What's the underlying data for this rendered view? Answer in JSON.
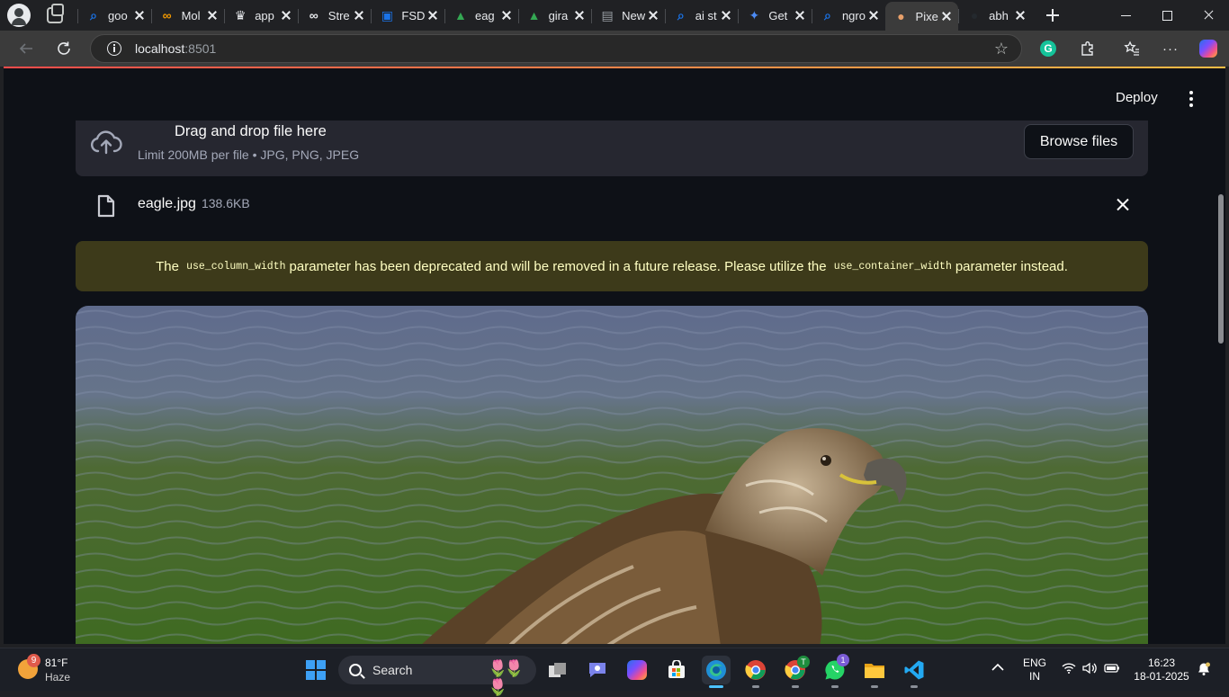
{
  "browser": {
    "tabs": [
      {
        "label": "goo",
        "favicon": "search-icon",
        "color": "#1a73e8"
      },
      {
        "label": "Mol",
        "favicon": "infinity-icon",
        "color": "#f29900"
      },
      {
        "label": "app",
        "favicon": "crown-icon",
        "color": "#e8eaed"
      },
      {
        "label": "Stre",
        "favicon": "infinity-icon",
        "color": "#e8eaed"
      },
      {
        "label": "FSD",
        "favicon": "classroom-icon",
        "color": "#1a73e8"
      },
      {
        "label": "eag",
        "favicon": "drive-icon",
        "color": "#34a853"
      },
      {
        "label": "gira",
        "favicon": "drive-icon",
        "color": "#34a853"
      },
      {
        "label": "New",
        "favicon": "page-icon",
        "color": "#9aa0a6"
      },
      {
        "label": "ai st",
        "favicon": "search-icon",
        "color": "#1a73e8"
      },
      {
        "label": "Get",
        "favicon": "butterfly-icon",
        "color": "#4c8bf5"
      },
      {
        "label": "ngro",
        "favicon": "search-icon",
        "color": "#1a73e8"
      },
      {
        "label": "Pixe",
        "favicon": "palette-icon",
        "color": "#e8a06a"
      },
      {
        "label": "abh",
        "favicon": "github-icon",
        "color": "#24292e"
      }
    ],
    "active_tab_index": 11,
    "url_host": "localhost",
    "url_port": ":8501"
  },
  "app": {
    "deploy_label": "Deploy",
    "uploader": {
      "title": "Drag and drop file here",
      "subtitle": "Limit 200MB per file • JPG, PNG, JPEG",
      "browse_label": "Browse files"
    },
    "file": {
      "name": "eagle.jpg",
      "size": "138.6KB"
    },
    "warning": {
      "pre": "The",
      "code1": "use_column_width",
      "mid": "parameter has been deprecated and will be removed in a future release. Please utilize the",
      "code2": "use_container_width",
      "post": "parameter instead."
    },
    "accent_color": "#ff4b4b",
    "warning_bg": "#3d3a1a",
    "warning_fg": "#ffffc2"
  },
  "taskbar": {
    "weather_temp": "81°F",
    "weather_desc": "Haze",
    "weather_badge": "9",
    "search_label": "Search",
    "lang_line1": "ENG",
    "lang_line2": "IN",
    "time": "16:23",
    "date": "18-01-2025",
    "whatsapp_badge": "1",
    "chrome_profile_badge": "T"
  }
}
